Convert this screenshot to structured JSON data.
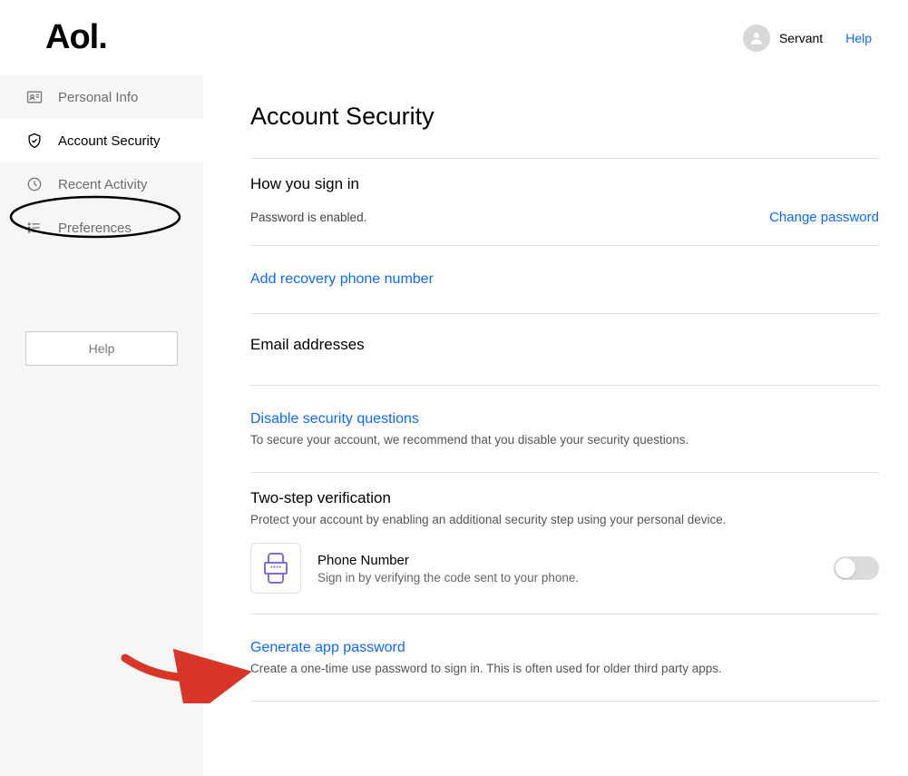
{
  "header": {
    "logo": "Aol.",
    "username": "Servant",
    "help": "Help"
  },
  "sidebar": {
    "items": [
      {
        "label": "Personal Info"
      },
      {
        "label": "Account Security"
      },
      {
        "label": "Recent Activity"
      },
      {
        "label": "Preferences"
      }
    ],
    "help_button": "Help"
  },
  "page": {
    "title": "Account Security",
    "signin": {
      "heading": "How you sign in",
      "status": "Password is enabled.",
      "change": "Change password"
    },
    "recovery": {
      "link": "Add recovery phone number"
    },
    "email": {
      "heading": "Email addresses"
    },
    "questions": {
      "link": "Disable security questions",
      "sub": "To secure your account, we recommend that you disable your security questions."
    },
    "twostep": {
      "heading": "Two-step verification",
      "sub": "Protect your account by enabling an additional security step using your personal device.",
      "phone_title": "Phone Number",
      "phone_sub": "Sign in by verifying the code sent to your phone."
    },
    "apppw": {
      "link": "Generate app password",
      "sub": "Create a one-time use password to sign in. This is often used for older third party apps."
    }
  }
}
